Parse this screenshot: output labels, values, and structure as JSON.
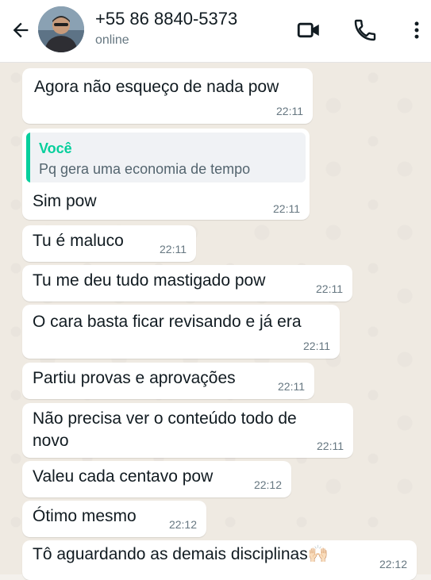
{
  "header": {
    "contact_name": "+55 86 8840-5373",
    "status": "online",
    "icons": [
      "back-arrow-icon",
      "video-call-icon",
      "phone-icon",
      "more-options-icon"
    ]
  },
  "colors": {
    "bubble": "#ffffff",
    "chat_background": "#efeae2",
    "quote_accent": "#06cf9c",
    "timestamp": "#667781"
  },
  "messages": [
    {
      "text": "Agora não esqueço de nada pow",
      "time": "22:11"
    },
    {
      "quote_author": "Você",
      "quote_text": "Pq gera uma economia de tempo",
      "text": "Sim pow",
      "time": "22:11"
    },
    {
      "text": "Tu é maluco",
      "time": "22:11"
    },
    {
      "text": "Tu me deu tudo mastigado pow",
      "time": "22:11"
    },
    {
      "text": "O cara basta ficar revisando e já era",
      "time": "22:11"
    },
    {
      "text": "Partiu provas e aprovações",
      "time": "22:11"
    },
    {
      "text": "Não precisa ver o conteúdo todo de novo",
      "time": "22:11"
    },
    {
      "text": "Valeu cada centavo pow",
      "time": "22:12"
    },
    {
      "text": "Ótimo mesmo",
      "time": "22:12"
    },
    {
      "text": "Tô aguardando as demais disciplinas",
      "emoji": "🙌🏻",
      "time": "22:12"
    }
  ]
}
